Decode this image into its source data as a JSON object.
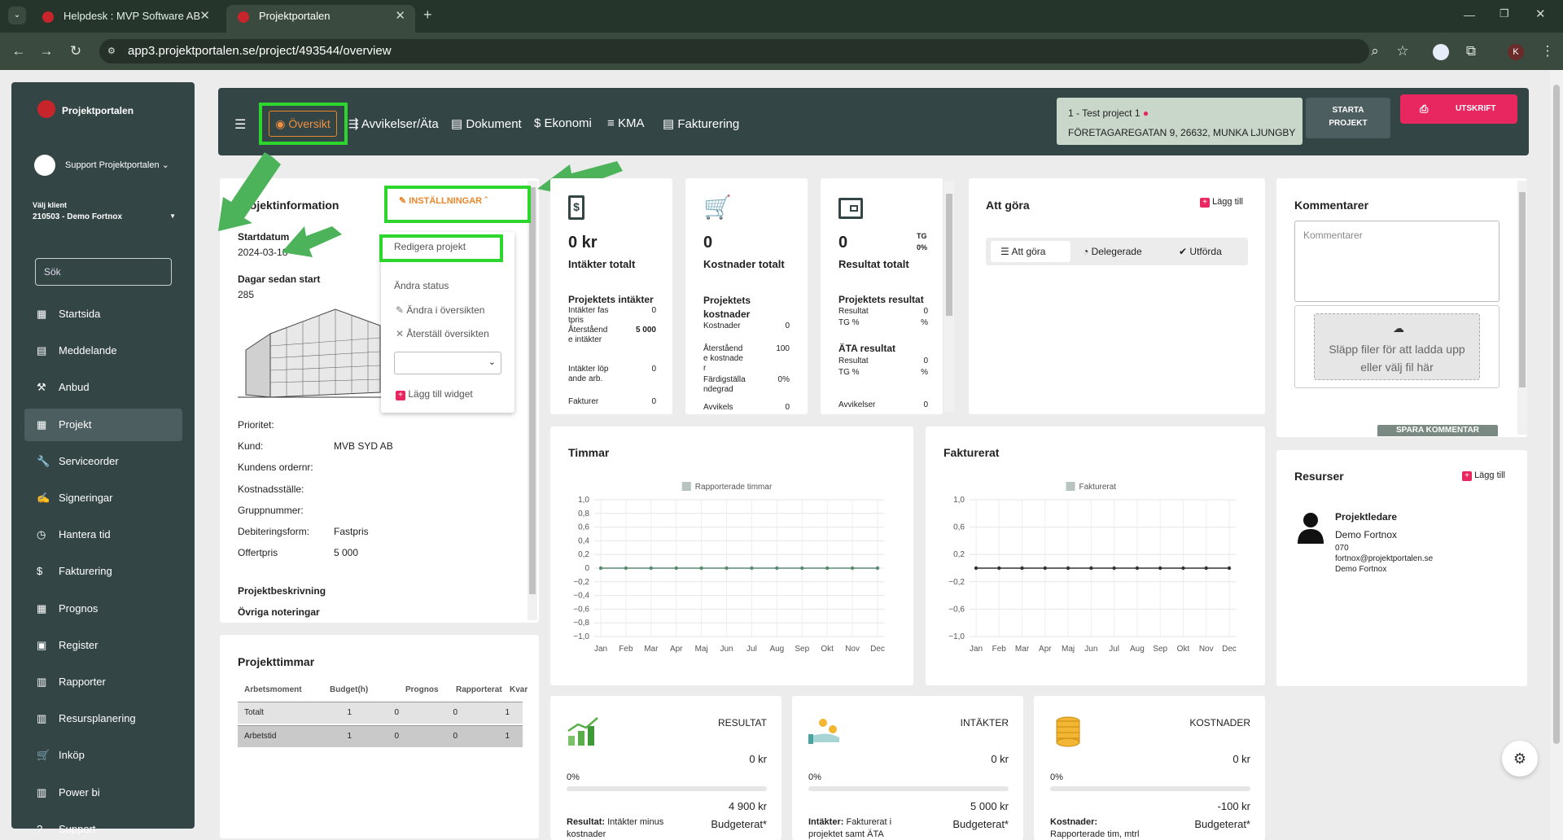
{
  "browser": {
    "tabs": [
      {
        "label": "Helpdesk : MVP Software AB"
      },
      {
        "label": "Projektportalen"
      }
    ],
    "url": "app3.projektportalen.se/project/493544/overview",
    "profile": "K"
  },
  "sidebar": {
    "brand": "Projektportalen",
    "user": "Support Projektportalen",
    "client_label": "Välj klient",
    "client_value": "210503 - Demo Fortnox",
    "search_placeholder": "Sök",
    "items": [
      {
        "label": "Startsida",
        "icon": "grid-icon"
      },
      {
        "label": "Meddelande",
        "icon": "message-icon"
      },
      {
        "label": "Anbud",
        "icon": "gavel-icon"
      },
      {
        "label": "Projekt",
        "icon": "dashboard-icon"
      },
      {
        "label": "Serviceorder",
        "icon": "wrench-icon"
      },
      {
        "label": "Signeringar",
        "icon": "sign-icon"
      },
      {
        "label": "Hantera tid",
        "icon": "clock-icon"
      },
      {
        "label": "Fakturering",
        "icon": "dollar-icon"
      },
      {
        "label": "Prognos",
        "icon": "dashboard-icon"
      },
      {
        "label": "Register",
        "icon": "image-icon"
      },
      {
        "label": "Rapporter",
        "icon": "calendar-icon"
      },
      {
        "label": "Resursplanering",
        "icon": "calendar-icon"
      },
      {
        "label": "Inköp",
        "icon": "cart-icon"
      },
      {
        "label": "Power bi",
        "icon": "chart-icon"
      },
      {
        "label": "Support",
        "icon": "help-icon"
      }
    ]
  },
  "topnav": {
    "tabs": [
      "Översikt",
      "Avvikelser/Äta",
      "Dokument",
      "Ekonomi",
      "KMA",
      "Fakturering"
    ],
    "project_name": "1 - Test project 1",
    "project_address": "FÖRETAGAREGATAN 9, 26632, MUNKA LJUNGBY",
    "start_label": "STARTA PROJEKT",
    "print_label": "UTSKRIFT"
  },
  "projinfo": {
    "title": "Projektinformation",
    "settings_label": "INSTÄLLNINGAR",
    "start_label": "Startdatum",
    "start_value": "2024-03-18",
    "days_label": "Dagar sedan start",
    "days_value": "285",
    "menu": [
      "Redigera projekt",
      "Ändra status",
      "Ändra i översikten",
      "Återställ översikten",
      "Lägg till widget"
    ],
    "fields": [
      {
        "label": "Prioritet:",
        "value": ""
      },
      {
        "label": "Kund:",
        "value": "MVB SYD AB"
      },
      {
        "label": "Kundens ordernr:",
        "value": ""
      },
      {
        "label": "Kostnadsställe:",
        "value": ""
      },
      {
        "label": "Gruppnummer:",
        "value": ""
      },
      {
        "label": "Debiteringsform:",
        "value": "Fastpris"
      },
      {
        "label": "Offertpris",
        "value": "5 000"
      }
    ],
    "desc_label": "Projektbeskrivning",
    "notes_label": "Övriga noteringar"
  },
  "kpi": {
    "income": {
      "value": "0 kr",
      "label": "Intäkter totalt",
      "section": "Projektets intäkter",
      "rows": [
        [
          "Intäkter fastpris",
          "0"
        ],
        [
          "Återstående intäkter",
          "5 000"
        ],
        [
          "Intäkter löpande arb.",
          "0"
        ],
        [
          "Fakturer",
          "0"
        ]
      ]
    },
    "cost": {
      "value": "0",
      "label": "Kostnader totalt",
      "section": "Projektets kostnader",
      "rows": [
        [
          "Kostnader",
          "0"
        ],
        [
          "Återstående kostnader",
          "100"
        ],
        [
          "Färdigställandegrad",
          "0%"
        ],
        [
          "Avvikels",
          "0"
        ]
      ]
    },
    "result": {
      "value": "0",
      "label": "Resultat totalt",
      "tg": "TG",
      "tg_pct": "0%",
      "section": "Projektets resultat",
      "rows": [
        [
          "Resultat",
          "0"
        ],
        [
          "TG %",
          "%"
        ]
      ],
      "ata_title": "ÄTA resultat",
      "ata_rows": [
        [
          "Resultat",
          "0"
        ],
        [
          "TG %",
          "%"
        ],
        [
          "Avvikelser",
          "0"
        ]
      ]
    }
  },
  "todo": {
    "title": "Att göra",
    "add_label": "Lägg till",
    "tabs": [
      "Att göra",
      "Delegerade",
      "Utförda"
    ]
  },
  "comments": {
    "title": "Kommentarer",
    "placeholder": "Kommentarer",
    "drop_text": "Släpp filer för att ladda upp eller välj fil här",
    "save_label": "SPARA KOMMENTAR"
  },
  "resources": {
    "title": "Resurser",
    "add_label": "Lägg till",
    "role": "Projektledare",
    "name": "Demo Fortnox",
    "phone": "070",
    "email": "fortnox@projektportalen.se",
    "company": "Demo Fortnox"
  },
  "hours": {
    "title": "Projekttimmar",
    "headers": [
      "Arbetsmoment",
      "Budget(h)",
      "Prognos",
      "Rapporterat",
      "Kvar"
    ],
    "rows": [
      [
        "Totalt",
        "1",
        "0",
        "0",
        "1"
      ],
      [
        "Arbetstid",
        "1",
        "0",
        "0",
        "1"
      ]
    ]
  },
  "chart_data": [
    {
      "type": "line",
      "title": "Timmar",
      "series": [
        {
          "name": "Rapporterade timmar",
          "values": [
            0,
            0,
            0,
            0,
            0,
            0,
            0,
            0,
            0,
            0,
            0,
            0
          ]
        }
      ],
      "categories": [
        "Jan",
        "Feb",
        "Mar",
        "Apr",
        "Maj",
        "Jun",
        "Jul",
        "Aug",
        "Sep",
        "Okt",
        "Nov",
        "Dec"
      ],
      "yticks": [
        "1,0",
        "0,8",
        "0,6",
        "0,4",
        "0,2",
        "0",
        "−0,2",
        "−0,4",
        "−0,6",
        "−0,8",
        "−1,0"
      ],
      "ylim": [
        -1,
        1
      ],
      "legend": "top"
    },
    {
      "type": "line",
      "title": "Fakturerat",
      "series": [
        {
          "name": "Fakturerat",
          "values": [
            0,
            0,
            0,
            0,
            0,
            0,
            0,
            0,
            0,
            0,
            0,
            0
          ]
        }
      ],
      "categories": [
        "Jan",
        "Feb",
        "Mar",
        "Apr",
        "Maj",
        "Jun",
        "Jul",
        "Aug",
        "Sep",
        "Okt",
        "Nov",
        "Dec"
      ],
      "yticks": [
        "1,0",
        "0,6",
        "0,2",
        "−0,2",
        "−0,6",
        "−1,0"
      ],
      "ylim": [
        -1,
        1
      ],
      "legend": "top"
    }
  ],
  "summary": [
    {
      "title": "RESULTAT",
      "value": "0 kr",
      "pct": "0%",
      "budget": "4 900 kr",
      "budget_label": "Budgeterat*",
      "desc_bold": "Resultat:",
      "desc": "Intäkter minus kostnader"
    },
    {
      "title": "INTÄKTER",
      "value": "0 kr",
      "pct": "0%",
      "budget": "5 000 kr",
      "budget_label": "Budgeterat*",
      "desc_bold": "Intäkter:",
      "desc": "Fakturerat i projektet samt ÄTA"
    },
    {
      "title": "KOSTNADER",
      "value": "0 kr",
      "pct": "0%",
      "budget": "-100 kr",
      "budget_label": "Budgeterat*",
      "desc_bold": "Kostnader:",
      "desc": "Rapporterade tim, mtrl"
    }
  ]
}
